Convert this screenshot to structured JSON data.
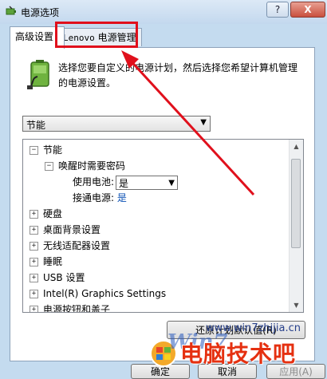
{
  "window": {
    "title": "电源选项",
    "help_label": "?",
    "close_label": "X"
  },
  "tabs": [
    {
      "label": "高级设置"
    },
    {
      "label_latin": "Lenovo",
      "label_cn": " 电源管理"
    }
  ],
  "panel": {
    "description": "选择您要自定义的电源计划，然后选择您希望计算机管理的电源设置。",
    "plan_select": {
      "value": "节能"
    },
    "tree": {
      "items": [
        {
          "label": "节能",
          "expander": "−"
        },
        {
          "label": "唤醒时需要密码",
          "expander": "−"
        },
        {
          "label": "使用电池:",
          "value": "是"
        },
        {
          "label": "接通电源:",
          "value": "是"
        },
        {
          "label": "硬盘",
          "expander": "+"
        },
        {
          "label": "桌面背景设置",
          "expander": "+"
        },
        {
          "label": "无线适配器设置",
          "expander": "+"
        },
        {
          "label": "睡眠",
          "expander": "+"
        },
        {
          "label": "USB 设置",
          "expander": "+"
        },
        {
          "label": "Intel(R) Graphics Settings",
          "expander": "+"
        },
        {
          "label": "电源按钮和盖子",
          "expander": "+"
        }
      ]
    },
    "restore_button": "还原计划默认值(R)"
  },
  "buttons": {
    "ok": "确定",
    "cancel": "取消",
    "apply": "应用(A)"
  },
  "watermark": {
    "url": "www.win7zhijia.cn",
    "big_text": "电脑技术吧",
    "win_text": "Win7"
  },
  "colors": {
    "highlight": "#e0101c",
    "arrow": "#e0101c",
    "link_blue": "#0a50b4"
  }
}
